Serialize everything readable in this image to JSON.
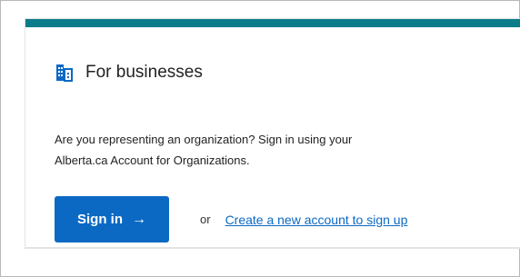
{
  "card": {
    "accent_color": "#0b7c8a",
    "icon": "building-icon",
    "title": "For businesses",
    "description_line1": "Are you representing an organization? Sign in using your",
    "description_line2": "Alberta.ca Account for Organizations."
  },
  "actions": {
    "sign_in_label": "Sign in",
    "sign_in_icon": "arrow-right-icon",
    "sign_in_arrow": "→",
    "button_color": "#0b69c4",
    "or_text": "or",
    "create_account_link": "Create a new account to sign up"
  }
}
